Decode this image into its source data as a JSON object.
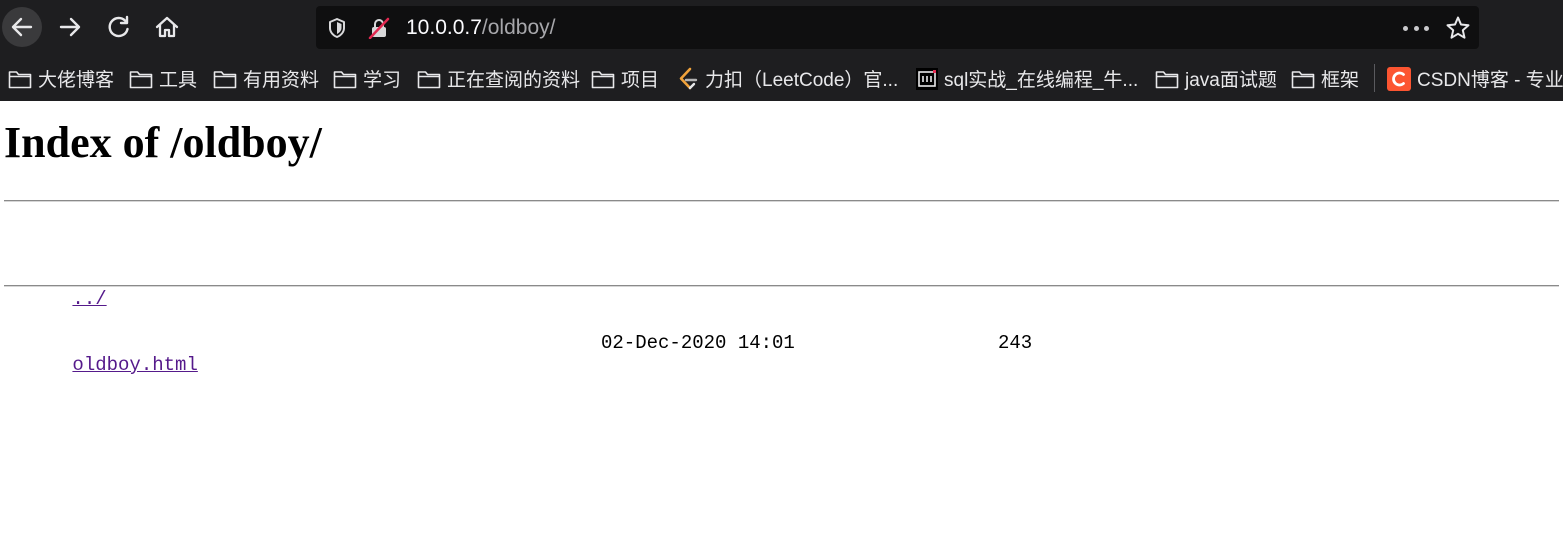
{
  "browser": {
    "nav": {
      "back_icon": "arrow-left-icon",
      "forward_icon": "arrow-right-icon",
      "reload_icon": "reload-icon",
      "home_icon": "home-icon"
    },
    "urlbar": {
      "host": "10.0.0.7",
      "path": "/oldboy/"
    },
    "bookmarks": [
      {
        "label": "大佬博客",
        "icon": "folder-icon"
      },
      {
        "label": "工具",
        "icon": "folder-icon"
      },
      {
        "label": "有用资料",
        "icon": "folder-icon"
      },
      {
        "label": "学习",
        "icon": "folder-icon"
      },
      {
        "label": "正在查阅的资料",
        "icon": "folder-icon"
      },
      {
        "label": "项目",
        "icon": "folder-icon"
      },
      {
        "label": "力扣（LeetCode）官...",
        "icon": "leetcode-icon"
      },
      {
        "label": "sql实战_在线编程_牛...",
        "icon": "nowcoder-icon"
      },
      {
        "label": "java面试题",
        "icon": "folder-icon"
      },
      {
        "label": "框架",
        "icon": "folder-icon"
      },
      {
        "label": "CSDN博客 - 专业",
        "icon": "csdn-icon"
      }
    ],
    "colors": {
      "toolbar_bg": "#1e1e20",
      "urlbar_bg": "#0f0f10",
      "link_visited": "#551a8b",
      "csdn_red": "#fc5531"
    }
  },
  "page": {
    "title": "Index of /oldboy/",
    "entries": [
      {
        "name": "../",
        "date": "",
        "size": ""
      },
      {
        "name": "oldboy.html",
        "date": "02-Dec-2020 14:01",
        "size": "243"
      }
    ]
  }
}
